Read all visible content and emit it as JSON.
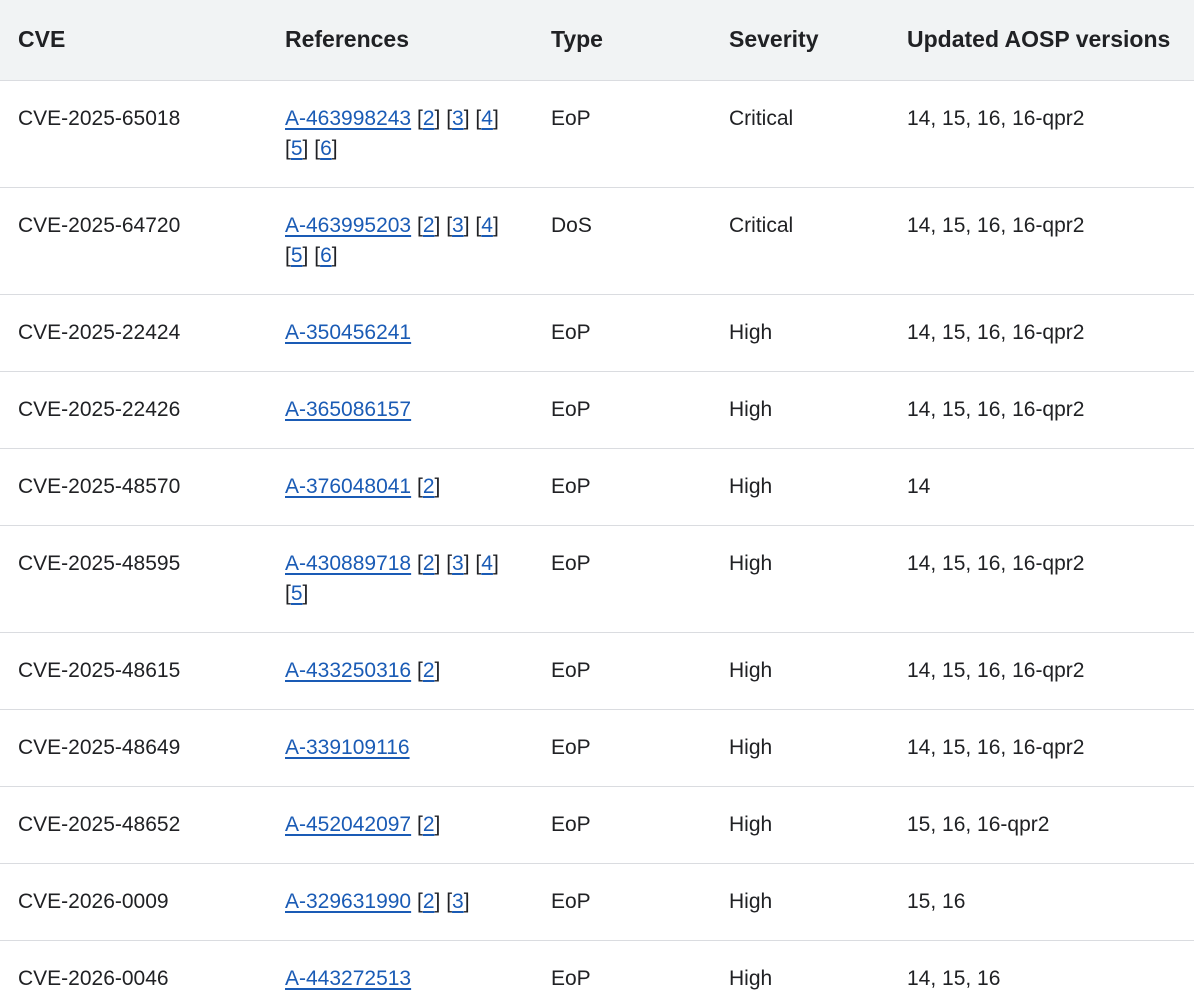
{
  "headers": {
    "cve": "CVE",
    "references": "References",
    "type": "Type",
    "severity": "Severity",
    "versions": "Updated AOSP versions"
  },
  "rows": [
    {
      "cve": "CVE-2025-65018",
      "refs": [
        "A-463998243",
        "2",
        "3",
        "4",
        "5",
        "6"
      ],
      "type": "EoP",
      "severity": "Critical",
      "versions": "14, 15, 16, 16-qpr2"
    },
    {
      "cve": "CVE-2025-64720",
      "refs": [
        "A-463995203",
        "2",
        "3",
        "4",
        "5",
        "6"
      ],
      "type": "DoS",
      "severity": "Critical",
      "versions": "14, 15, 16, 16-qpr2"
    },
    {
      "cve": "CVE-2025-22424",
      "refs": [
        "A-350456241"
      ],
      "type": "EoP",
      "severity": "High",
      "versions": "14, 15, 16, 16-qpr2"
    },
    {
      "cve": "CVE-2025-22426",
      "refs": [
        "A-365086157"
      ],
      "type": "EoP",
      "severity": "High",
      "versions": "14, 15, 16, 16-qpr2"
    },
    {
      "cve": "CVE-2025-48570",
      "refs": [
        "A-376048041",
        "2"
      ],
      "type": "EoP",
      "severity": "High",
      "versions": "14"
    },
    {
      "cve": "CVE-2025-48595",
      "refs": [
        "A-430889718",
        "2",
        "3",
        "4",
        "5"
      ],
      "type": "EoP",
      "severity": "High",
      "versions": "14, 15, 16, 16-qpr2"
    },
    {
      "cve": "CVE-2025-48615",
      "refs": [
        "A-433250316",
        "2"
      ],
      "type": "EoP",
      "severity": "High",
      "versions": "14, 15, 16, 16-qpr2"
    },
    {
      "cve": "CVE-2025-48649",
      "refs": [
        "A-339109116"
      ],
      "type": "EoP",
      "severity": "High",
      "versions": "14, 15, 16, 16-qpr2"
    },
    {
      "cve": "CVE-2025-48652",
      "refs": [
        "A-452042097",
        "2"
      ],
      "type": "EoP",
      "severity": "High",
      "versions": "15, 16, 16-qpr2"
    },
    {
      "cve": "CVE-2026-0009",
      "refs": [
        "A-329631990",
        "2",
        "3"
      ],
      "type": "EoP",
      "severity": "High",
      "versions": "15, 16"
    },
    {
      "cve": "CVE-2026-0046",
      "refs": [
        "A-443272513"
      ],
      "type": "EoP",
      "severity": "High",
      "versions": "14, 15, 16"
    }
  ],
  "colors": {
    "link": "#1a5bb5",
    "header_bg": "#f1f3f4",
    "border": "#dadce0",
    "text": "#202124"
  }
}
